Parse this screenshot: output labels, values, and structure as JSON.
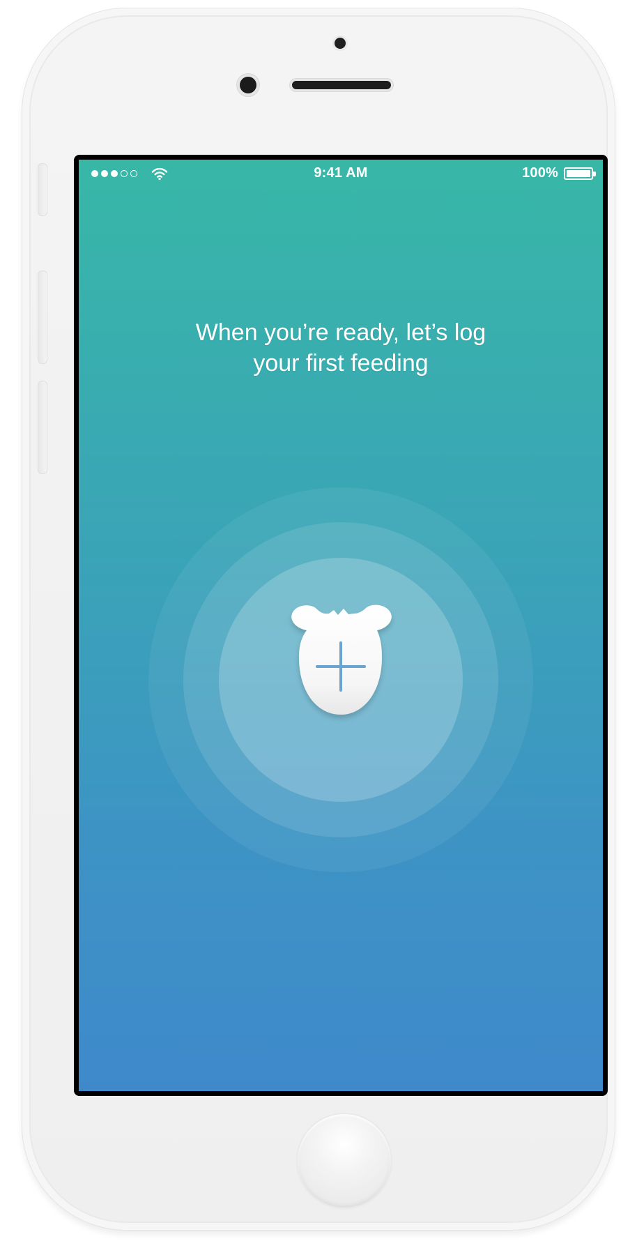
{
  "status_bar": {
    "time": "9:41 AM",
    "battery_percent": "100%",
    "signal_bars_filled": 3,
    "signal_bars_total": 5,
    "wifi_icon": "wifi-icon",
    "battery_icon": "battery-icon"
  },
  "main": {
    "prompt_text": "When you’re ready, let’s log\nyour first feeding",
    "add_button_icon": "plus-icon",
    "mascot_icon": "bear-face-icon"
  },
  "device": {
    "home_button_icon": "home-button-icon",
    "frame_color": "#f2f2f2",
    "screen_gradient_top": "#38b7a7",
    "screen_gradient_bottom": "#3f89cb",
    "plus_color": "#6aa5cf"
  }
}
